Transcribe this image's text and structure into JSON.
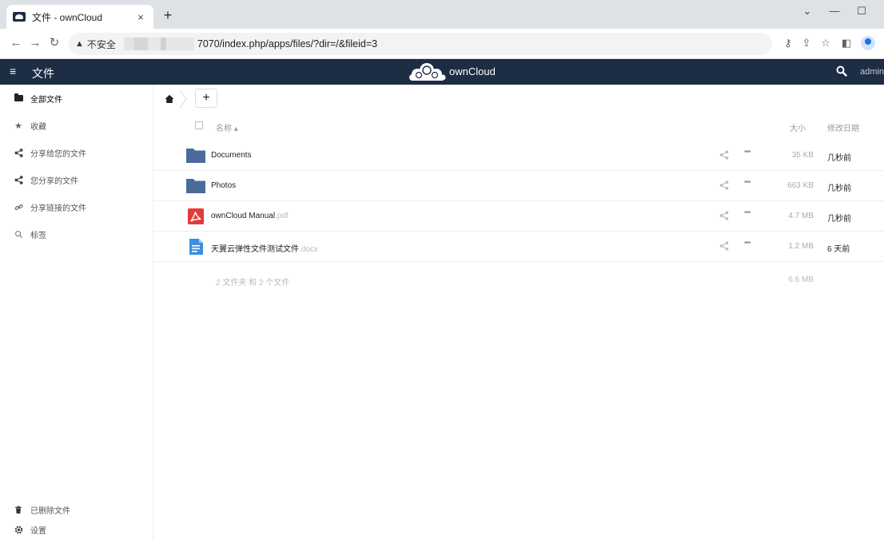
{
  "browser": {
    "tab_title": "文件 - ownCloud",
    "tab_close": "×",
    "new_tab": "+",
    "insecure_label": "不安全",
    "url": "7070/index.php/apps/files/?dir=/&fileid=3"
  },
  "header": {
    "menu_icon": "≡",
    "app_title": "文件",
    "brand": "ownCloud",
    "user": "admin"
  },
  "sidebar": {
    "items": [
      {
        "label": "全部文件",
        "icon": "folder-icon"
      },
      {
        "label": "收藏",
        "icon": "star-icon"
      },
      {
        "label": "分享给您的文件",
        "icon": "share-icon"
      },
      {
        "label": "您分享的文件",
        "icon": "share-icon"
      },
      {
        "label": "分享链接的文件",
        "icon": "link-icon"
      },
      {
        "label": "标签",
        "icon": "tag-search-icon"
      }
    ],
    "bottom": [
      {
        "label": "已删除文件",
        "icon": "trash-icon"
      },
      {
        "label": "设置",
        "icon": "gear-icon"
      }
    ]
  },
  "toolbar": {
    "add_label": "+"
  },
  "table": {
    "headers": {
      "name": "名称 ▴",
      "size": "大小",
      "date": "修改日期"
    },
    "rows": [
      {
        "type": "folder",
        "name": "Documents",
        "ext": "",
        "size": "35 KB",
        "date": "几秒前"
      },
      {
        "type": "folder",
        "name": "Photos",
        "ext": "",
        "size": "663 KB",
        "date": "几秒前"
      },
      {
        "type": "pdf",
        "name": "ownCloud Manual",
        "ext": ".pdf",
        "size": "4.7 MB",
        "date": "几秒前"
      },
      {
        "type": "docx",
        "name": "天翼云弹性文件测试文件",
        "ext": ".docx",
        "size": "1.2 MB",
        "date": "6 天前"
      }
    ],
    "more_label": "•••",
    "summary": {
      "text": "2 文件夹 和 2 个文件",
      "size": "6.6 MB"
    }
  },
  "colors": {
    "header_bg": "#1d2d44",
    "folder": "#4a6c9b",
    "pdf": "#e23b3b",
    "docx": "#3b8fe0"
  }
}
